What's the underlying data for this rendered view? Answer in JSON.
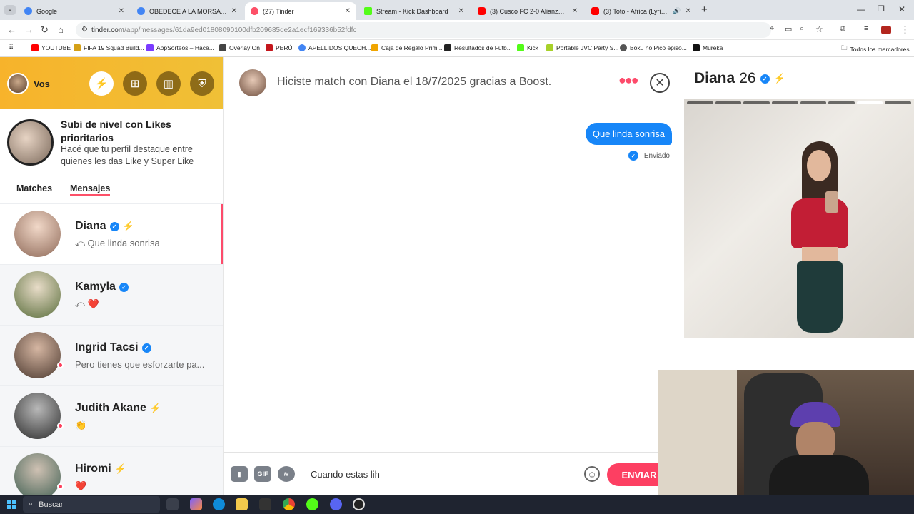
{
  "browser": {
    "tabs": [
      {
        "title": "Google",
        "color": "#4285f4",
        "active": false
      },
      {
        "title": "OBEDECE A LA MORSA - Busca",
        "color": "#4285f4",
        "active": false
      },
      {
        "title": "(27) Tinder",
        "color": "#fd5068",
        "active": true
      },
      {
        "title": "Stream - Kick Dashboard",
        "color": "#53fc18",
        "active": false
      },
      {
        "title": "(3) Cusco FC 2-0 Alianza Lima:",
        "color": "#ff0000",
        "active": false
      },
      {
        "title": "(3) Toto - Africa (Lyrics) - Yo",
        "color": "#ff0000",
        "active": false
      }
    ],
    "url_host": "tinder.com",
    "url_path": "/app/messages/61da9ed01808090100dfb209685de2a1ecf169336b52fdfc",
    "bookmarks": [
      {
        "label": "YOUTUBE",
        "color": "#ff0000"
      },
      {
        "label": "FIFA 19 Squad Build...",
        "color": "#d4a017"
      },
      {
        "label": "AppSorteos – Hace...",
        "color": "#7a3cff"
      },
      {
        "label": "Overlay On",
        "color": "#444"
      },
      {
        "label": "PERÚ",
        "color": "#c4161c"
      },
      {
        "label": "APELLIDOS QUECH...",
        "color": "#4285f4"
      },
      {
        "label": "Caja de Regalo Prim...",
        "color": "#f0a500"
      },
      {
        "label": "Resultados de Fútb...",
        "color": "#222"
      },
      {
        "label": "Kick",
        "color": "#53fc18"
      },
      {
        "label": "Portable JVC Party S...",
        "color": "#a7d129"
      },
      {
        "label": "Boku no Pico episo...",
        "color": "#555"
      },
      {
        "label": "Mureka",
        "color": "#111"
      }
    ],
    "all_bookmarks": "Todos los marcadores"
  },
  "sidebar": {
    "user_label": "Vos",
    "promo_title": "Subí de nivel con Likes prioritarios",
    "promo_subtitle": "Hacé que tu perfil destaque entre quienes les das Like y Super Like",
    "tabs": [
      "Matches",
      "Mensajes"
    ],
    "conversations": [
      {
        "name": "Diana",
        "message": "⤺ Que linda sonrisa",
        "verified": true,
        "boost": true,
        "online": false,
        "active": true
      },
      {
        "name": "Kamyla",
        "message": "⤺ ❤️",
        "verified": true,
        "boost": false,
        "online": false,
        "active": false
      },
      {
        "name": "Ingrid Tacsi",
        "message": "Pero tienes que esforzarte pa...",
        "verified": true,
        "boost": false,
        "online": true,
        "active": false
      },
      {
        "name": "Judith Akane",
        "message": "👏",
        "verified": false,
        "boost": true,
        "online": true,
        "active": false
      },
      {
        "name": "Hiromi",
        "message": "❤️",
        "verified": false,
        "boost": true,
        "online": true,
        "active": false
      }
    ]
  },
  "chat": {
    "header": "Hiciste match con Diana el 18/7/2025 gracias a Boost.",
    "messages": [
      {
        "text": "Que linda sonrisa",
        "status": "Enviado"
      }
    ],
    "composer_icons": [
      "GIF"
    ],
    "input_text": "Cuando estas lih",
    "send_label": "ENVIAR"
  },
  "profile": {
    "name": "Diana",
    "age": "26",
    "photo_count": 8,
    "active_photo_index": 6
  },
  "taskbar": {
    "search_label": "Buscar"
  },
  "colors": {
    "brand": "#fd5068",
    "accent_blue": "#1786f8",
    "header_gold": "#f2bd31"
  }
}
